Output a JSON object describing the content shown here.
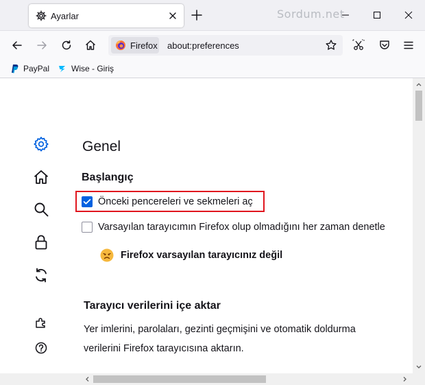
{
  "window": {
    "watermark": "Sordum.net"
  },
  "tab": {
    "title": "Ayarlar"
  },
  "navbar": {
    "identity_label": "Firefox",
    "url": "about:preferences"
  },
  "bookmarks": [
    {
      "label": "PayPal",
      "icon": "paypal-icon"
    },
    {
      "label": "Wise - Giriş",
      "icon": "wise-icon"
    }
  ],
  "sidebar": {
    "icons": [
      "gear-icon",
      "home-icon",
      "search-icon",
      "lock-icon",
      "sync-icon",
      "extensions-icon",
      "help-icon"
    ]
  },
  "main": {
    "title": "Genel",
    "startup": {
      "heading": "Başlangıç",
      "restore_session_label": "Önceki pencereleri ve sekmeleri aç",
      "restore_session_checked": true,
      "default_check_label": "Varsayılan tarayıcımın Firefox olup olmadığını her zaman denetle",
      "default_check_checked": false,
      "not_default_text": "Firefox varsayılan tarayıcınız değil"
    },
    "import": {
      "heading": "Tarayıcı verilerini içe aktar",
      "description": "Yer imlerini, parolaları, gezinti geçmişini ve otomatik doldurma verilerini Firefox tarayıcısına aktarın."
    }
  },
  "colors": {
    "accent": "#0061e0",
    "highlight_border": "#e0151e",
    "titlebar": "#f0f0f4"
  }
}
